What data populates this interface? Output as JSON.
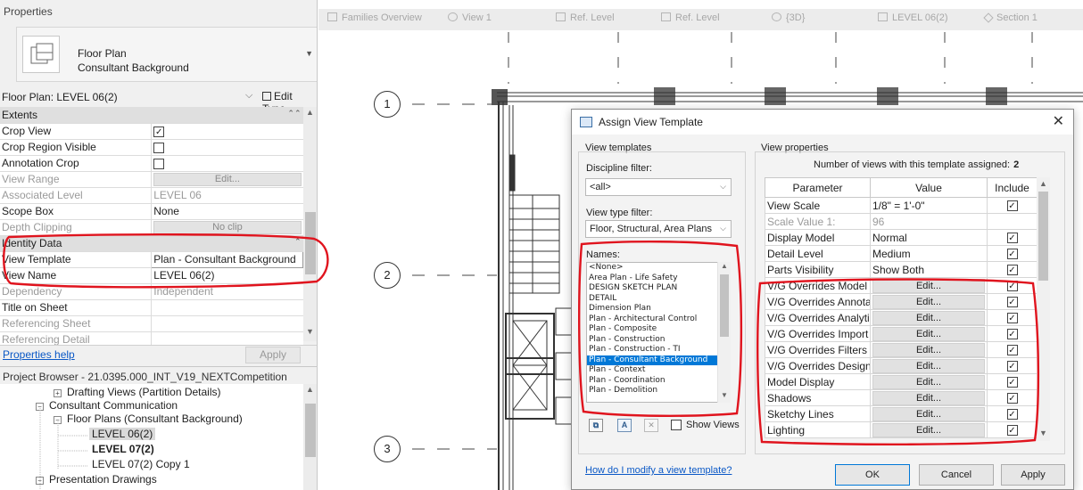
{
  "properties": {
    "title": "Properties",
    "type_name_line1": "Floor Plan",
    "type_name_line2": "Consultant Background",
    "instance_selector": "Floor Plan: LEVEL 06(2)",
    "edit_type": "Edit Type",
    "groups": {
      "extents": "Extents",
      "identity": "Identity Data"
    },
    "rows": {
      "crop_view": "Crop View",
      "crop_region_visible": "Crop Region Visible",
      "annotation_crop": "Annotation Crop",
      "view_range": "View Range",
      "view_range_btn": "Edit...",
      "associated_level": "Associated Level",
      "associated_level_val": "LEVEL 06",
      "scope_box": "Scope Box",
      "scope_box_val": "None",
      "depth_clipping": "Depth Clipping",
      "depth_clipping_btn": "No clip",
      "view_template": "View Template",
      "view_template_val": "Plan - Consultant Background",
      "view_name": "View Name",
      "view_name_val": "LEVEL 06(2)",
      "dependency": "Dependency",
      "dependency_val": "Independent",
      "title_on_sheet": "Title on Sheet",
      "referencing_sheet": "Referencing Sheet",
      "referencing_detail": "Referencing Detail"
    },
    "help": "Properties help",
    "apply": "Apply"
  },
  "project_browser": {
    "title": "Project Browser - 21.0395.000_INT_V19_NEXTCompetition",
    "items": [
      "Drafting Views (Partition Details)",
      "Consultant Communication",
      "Floor Plans (Consultant Background)",
      "LEVEL 06(2)",
      "LEVEL 07(2)",
      "LEVEL 07(2) Copy 1",
      "Presentation Drawings"
    ]
  },
  "tabs": [
    "Families Overview",
    "View 1",
    "Ref. Level",
    "Ref. Level",
    "{3D}",
    "LEVEL 06(2)",
    "Section 1"
  ],
  "grid_bubbles": [
    "1",
    "2",
    "3"
  ],
  "dialog": {
    "title": "Assign View Template",
    "close": "✕",
    "view_templates_group": "View templates",
    "discipline_filter_label": "Discipline filter:",
    "discipline_filter_value": "<all>",
    "view_type_filter_label": "View type filter:",
    "view_type_filter_value": "Floor, Structural, Area Plans",
    "names_label": "Names:",
    "names": [
      "<None>",
      "Area Plan - Life Safety",
      "DESIGN SKETCH PLAN",
      "DETAIL",
      "Dimension Plan",
      "Plan - Architectural Control",
      "Plan - Composite",
      "Plan - Construction",
      "Plan - Construction - TI",
      "Plan - Consultant Background",
      "Plan - Context",
      "Plan - Coordination",
      "Plan - Demolition"
    ],
    "selected_name": "Plan - Consultant Background",
    "show_views": "Show Views",
    "view_properties_group": "View properties",
    "count_label": "Number of views with this template assigned:",
    "count_value": "2",
    "columns": [
      "Parameter",
      "Value",
      "Include"
    ],
    "rows": [
      {
        "param": "View Scale",
        "value": "1/8\" = 1'-0\"",
        "include": true
      },
      {
        "param": "Scale Value    1:",
        "value": "96",
        "include": null
      },
      {
        "param": "Display Model",
        "value": "Normal",
        "include": true
      },
      {
        "param": "Detail Level",
        "value": "Medium",
        "include": true
      },
      {
        "param": "Parts Visibility",
        "value": "Show Both",
        "include": true
      },
      {
        "param": "V/G Overrides Model",
        "value": "Edit...",
        "include": true
      },
      {
        "param": "V/G Overrides Annotati",
        "value": "Edit...",
        "include": true
      },
      {
        "param": "V/G Overrides Analytic",
        "value": "Edit...",
        "include": true
      },
      {
        "param": "V/G Overrides Import",
        "value": "Edit...",
        "include": true
      },
      {
        "param": "V/G Overrides Filters",
        "value": "Edit...",
        "include": true
      },
      {
        "param": "V/G Overrides Design",
        "value": "Edit...",
        "include": true
      },
      {
        "param": "Model Display",
        "value": "Edit...",
        "include": true
      },
      {
        "param": "Shadows",
        "value": "Edit...",
        "include": true
      },
      {
        "param": "Sketchy Lines",
        "value": "Edit...",
        "include": true
      },
      {
        "param": "Lighting",
        "value": "Edit...",
        "include": true
      }
    ],
    "help_link": "How do I modify a view template?",
    "ok": "OK",
    "cancel": "Cancel",
    "apply": "Apply"
  },
  "colors": {
    "highlight_red": "#e0141e",
    "selection_blue": "#0078d7",
    "link_blue": "#0a58c6"
  }
}
